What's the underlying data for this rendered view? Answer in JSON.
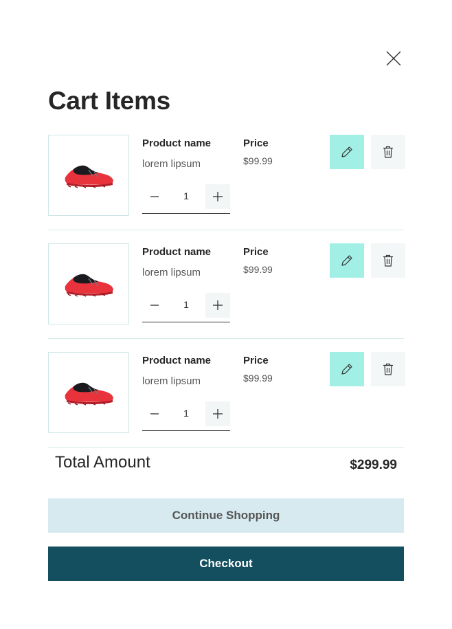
{
  "modal": {
    "title": "Cart Items",
    "close_icon": "close-icon"
  },
  "items": [
    {
      "name": "Product name",
      "description": "lorem lipsum",
      "price_label": "Price",
      "price": "$99.99",
      "quantity": "1",
      "image": "red-trail-running-shoe"
    },
    {
      "name": "Product name",
      "description": "lorem lipsum",
      "price_label": "Price",
      "price": "$99.99",
      "quantity": "1",
      "image": "red-trail-running-shoe"
    },
    {
      "name": "Product name",
      "description": "lorem lipsum",
      "price_label": "Price",
      "price": "$99.99",
      "quantity": "1",
      "image": "red-trail-running-shoe"
    }
  ],
  "icons": {
    "edit": "pencil-icon",
    "delete": "trash-icon",
    "decrement": "minus-icon",
    "increment": "plus-icon"
  },
  "summary": {
    "total_label": "Total Amount",
    "total_value": "$299.99"
  },
  "actions": {
    "continue_label": "Continue Shopping",
    "checkout_label": "Checkout"
  },
  "colors": {
    "edit_bg": "#a2efe6",
    "continue_bg": "#d7eaf0",
    "checkout_bg": "#134f5f"
  }
}
